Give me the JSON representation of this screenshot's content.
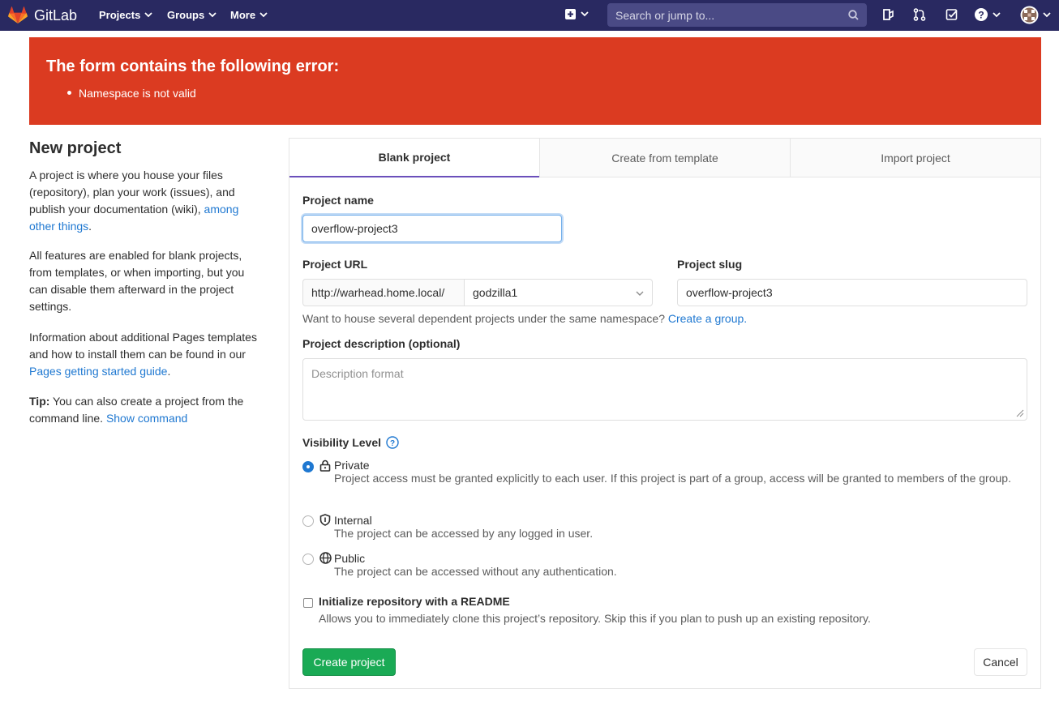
{
  "navbar": {
    "app_name": "GitLab",
    "menu": [
      {
        "label": "Projects"
      },
      {
        "label": "Groups"
      },
      {
        "label": "More"
      }
    ],
    "search_placeholder": "Search or jump to...",
    "icons": [
      "plus-square-icon",
      "todo-icon",
      "merge-request-icon",
      "issues-icon",
      "help-icon",
      "avatar"
    ]
  },
  "error": {
    "title": "The form contains the following error:",
    "items": [
      "Namespace is not valid"
    ]
  },
  "sidebar": {
    "title": "New project",
    "p1_text": "A project is where you house your files (repository), plan your work (issues), and publish your documentation (wiki),",
    "p1_link": "among other things",
    "p1_end": ".",
    "p2": "All features are enabled for blank projects, from templates, or when importing, but you can disable them afterward in the project settings.",
    "p3_text": "Information about additional Pages templates and how to install them can be found in our",
    "p3_link": "Pages getting started guide",
    "p3_end": ".",
    "tip_label": "Tip:",
    "tip_text": "You can also create a project from the command line.",
    "tip_link": "Show command"
  },
  "tabs": [
    {
      "label": "Blank project",
      "active": true
    },
    {
      "label": "Create from template",
      "active": false
    },
    {
      "label": "Import project",
      "active": false
    }
  ],
  "form": {
    "project_name_label": "Project name",
    "project_name_value": "overflow-project3",
    "project_url_label": "Project URL",
    "url_prefix": "http://warhead.home.local/",
    "namespace_value": "godzilla1",
    "project_slug_label": "Project slug",
    "project_slug_value": "overflow-project3",
    "group_help_text": "Want to house several dependent projects under the same namespace?",
    "group_help_link": "Create a group.",
    "description_label": "Project description (optional)",
    "description_placeholder": "Description format",
    "visibility_label": "Visibility Level",
    "visibility_options": [
      {
        "title": "Private",
        "desc": "Project access must be granted explicitly to each user. If this project is part of a group, access will be granted to members of the group.",
        "checked": true
      },
      {
        "title": "Internal",
        "desc": "The project can be accessed by any logged in user.",
        "checked": false
      },
      {
        "title": "Public",
        "desc": "The project can be accessed without any authentication.",
        "checked": false
      }
    ],
    "readme_label": "Initialize repository with a README",
    "readme_desc": "Allows you to immediately clone this project’s repository. Skip this if you plan to push up an existing repository.",
    "create_button": "Create project",
    "cancel_button": "Cancel"
  },
  "colors": {
    "navbar": "#292961",
    "error": "#db3b21",
    "primary": "#1aaa55",
    "link": "#1f78d1"
  }
}
